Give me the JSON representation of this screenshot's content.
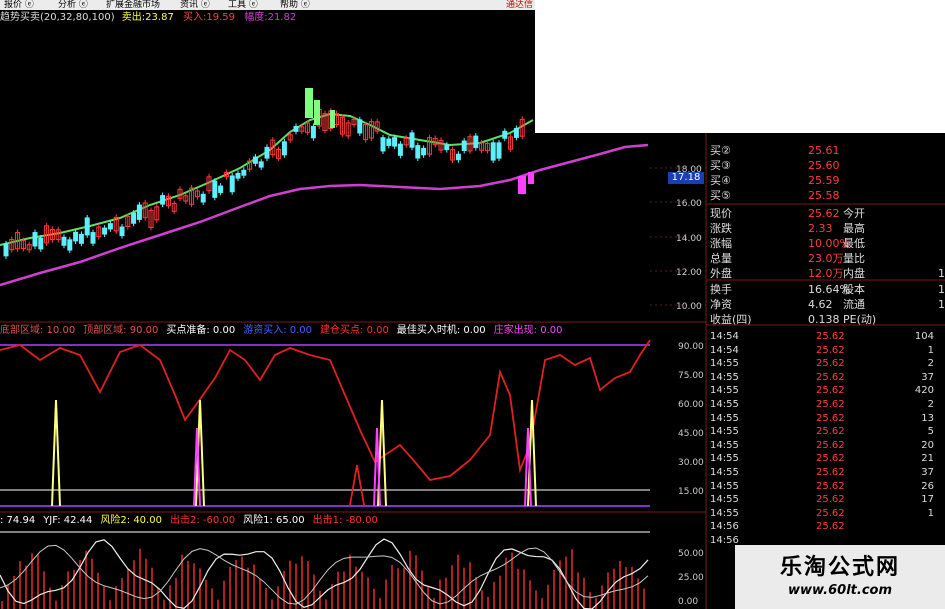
{
  "menu": {
    "items": [
      "报价 ⓔ",
      "分析 ⓔ",
      "扩展金融市场",
      "资讯 ⓔ",
      "工具 ⓔ",
      "帮助 ⓔ"
    ],
    "brand": "通达信"
  },
  "main_indicator": {
    "name": "趋势买卖(20,32,80,100)",
    "sell_label": "卖出:",
    "sell_value": "23.87",
    "buy_label": "买入:",
    "buy_value": "19.59",
    "range_label": "幅度:",
    "range_value": "21.82"
  },
  "price_axis": {
    "ticks": [
      "18.00",
      "16.00",
      "14.00",
      "12.00",
      "10.00"
    ],
    "last_price": "17.18"
  },
  "quote_panel": {
    "buy_levels": [
      {
        "label": "买②",
        "price": "25.61"
      },
      {
        "label": "买③",
        "price": "25.60"
      },
      {
        "label": "买④",
        "price": "25.59"
      },
      {
        "label": "买⑤",
        "price": "25.58"
      }
    ],
    "rows": [
      {
        "label": "现价",
        "value": "25.62",
        "right": "今开",
        "extra": ""
      },
      {
        "label": "涨跌",
        "value": "2.33",
        "right": "最高",
        "extra": ""
      },
      {
        "label": "涨幅",
        "value": "10.00%",
        "right": "最低",
        "extra": ""
      },
      {
        "label": "总量",
        "value": "23.0万",
        "right": "量比",
        "extra": ""
      },
      {
        "label": "外盘",
        "value": "12.0万",
        "right": "内盘",
        "extra": "1"
      },
      {
        "label": "换手",
        "value": "16.64%",
        "right": "股本",
        "extra": "1"
      },
      {
        "label": "净资",
        "value": "4.62",
        "right": "流通",
        "extra": "1"
      },
      {
        "label": "收益(四)",
        "value": "0.138",
        "right": "PE(动)",
        "extra": ""
      }
    ],
    "ticks": [
      {
        "time": "14:54",
        "price": "25.62",
        "vol": "104"
      },
      {
        "time": "14:54",
        "price": "25.62",
        "vol": "1"
      },
      {
        "time": "14:55",
        "price": "25.62",
        "vol": "2"
      },
      {
        "time": "14:55",
        "price": "25.62",
        "vol": "37"
      },
      {
        "time": "14:55",
        "price": "25.62",
        "vol": "420"
      },
      {
        "time": "14:55",
        "price": "25.62",
        "vol": "2"
      },
      {
        "time": "14:55",
        "price": "25.62",
        "vol": "13"
      },
      {
        "time": "14:55",
        "price": "25.62",
        "vol": "5"
      },
      {
        "time": "14:55",
        "price": "25.62",
        "vol": "20"
      },
      {
        "time": "14:55",
        "price": "25.62",
        "vol": "21"
      },
      {
        "time": "14:55",
        "price": "25.62",
        "vol": "37"
      },
      {
        "time": "14:55",
        "price": "25.62",
        "vol": "26"
      },
      {
        "time": "14:55",
        "price": "25.62",
        "vol": "17"
      },
      {
        "time": "14:55",
        "price": "25.62",
        "vol": "1"
      },
      {
        "time": "14:56",
        "price": "25.62",
        "vol": ""
      },
      {
        "time": "14:56",
        "price": "",
        "vol": ""
      }
    ]
  },
  "indicator2": {
    "items": [
      {
        "label": "底部区域: 10.00",
        "color": "#e05050"
      },
      {
        "label": "顶部区域: 90.00",
        "color": "#e05050"
      },
      {
        "label": "买点准备: 0.00",
        "color": "#ffffff"
      },
      {
        "label": "游资买入: 0.00",
        "color": "#4060ff"
      },
      {
        "label": "建仓买点: 0.00",
        "color": "#ff3030"
      },
      {
        "label": "最佳买入时机: 0.00",
        "color": "#ffffff"
      },
      {
        "label": "庄家出现: 0.00",
        "color": "#ff40ff"
      }
    ],
    "axis": [
      "90.00",
      "75.00",
      "60.00",
      "45.00",
      "30.00",
      "15.00"
    ]
  },
  "indicator3": {
    "items": [
      {
        "label": ": 74.94",
        "color": "#ffffff"
      },
      {
        "label": "YJF: 42.44",
        "color": "#ffffff"
      },
      {
        "label": "风险2: 40.00",
        "color": "#ffff40"
      },
      {
        "label": "出击2: -60.00",
        "color": "#ff3030"
      },
      {
        "label": "风险1: 65.00",
        "color": "#ffffff"
      },
      {
        "label": "出击1: -80.00",
        "color": "#ff3030"
      }
    ],
    "axis": [
      "50.00",
      "25.00",
      "0.00"
    ]
  },
  "watermark": {
    "title": "乐淘公式网",
    "url": "www.60lt.com"
  },
  "colors": {
    "up": "#ff3b3b",
    "down": "#5ff0ff",
    "ma_fast": "#60e060",
    "ma_slow": "#d040d0",
    "background": "#000000"
  }
}
